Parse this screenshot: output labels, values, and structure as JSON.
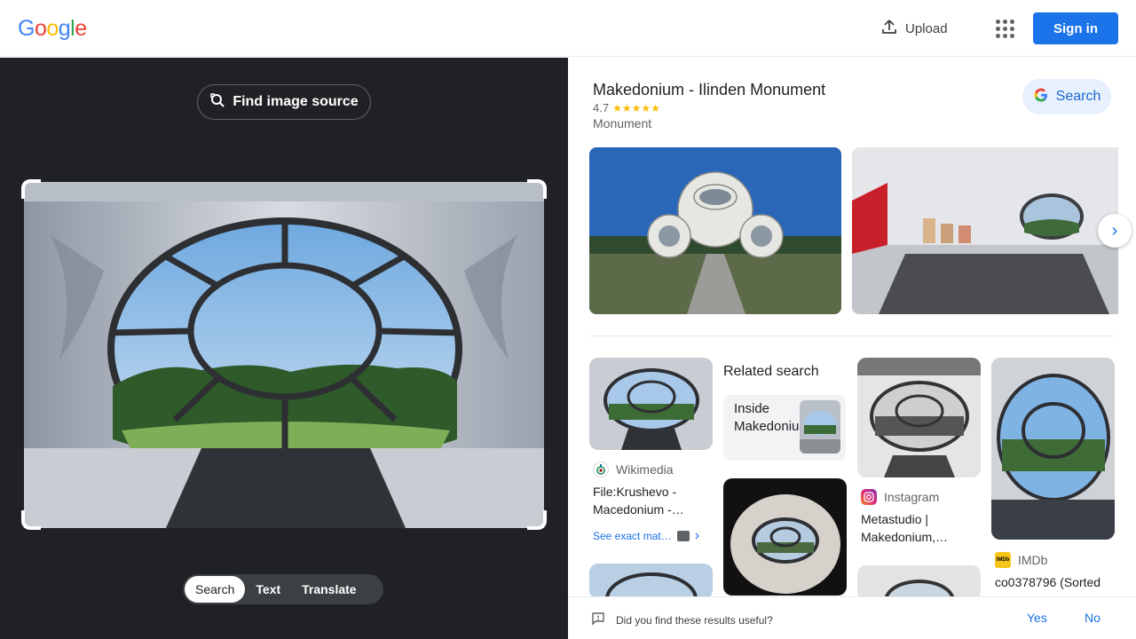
{
  "header": {
    "logo_letters": [
      "G",
      "o",
      "o",
      "g",
      "l",
      "e"
    ],
    "upload_label": "Upload",
    "apps_icon": "apps-grid-icon",
    "sign_in_label": "Sign in"
  },
  "left_panel": {
    "find_source_label": "Find image source",
    "modes": [
      "Search",
      "Text",
      "Translate"
    ],
    "active_mode": "Search"
  },
  "knowledge_panel": {
    "title": "Makedonium - Ilinden Monument",
    "rating": "4.7",
    "stars": "★★★★★",
    "type": "Monument",
    "search_label": "Search"
  },
  "results": {
    "wikimedia": {
      "source": "Wikimedia",
      "title": "File:Krushevo - Macedonium -…",
      "see_exact": "See exact mat…"
    },
    "related": {
      "heading": "Related search",
      "chip_text": "Inside Makedonium"
    },
    "instagram": {
      "source": "Instagram",
      "title": "Metastudio | Makedonium,…"
    },
    "imdb": {
      "source": "IMDb",
      "badge": "IMDb",
      "title": "co0378796 (Sorted"
    }
  },
  "feedback": {
    "question": "Did you find these results useful?",
    "yes": "Yes",
    "no": "No"
  },
  "colors": {
    "accent": "#1a73e8",
    "dark_panel": "#202124",
    "star": "#fbbc04"
  }
}
